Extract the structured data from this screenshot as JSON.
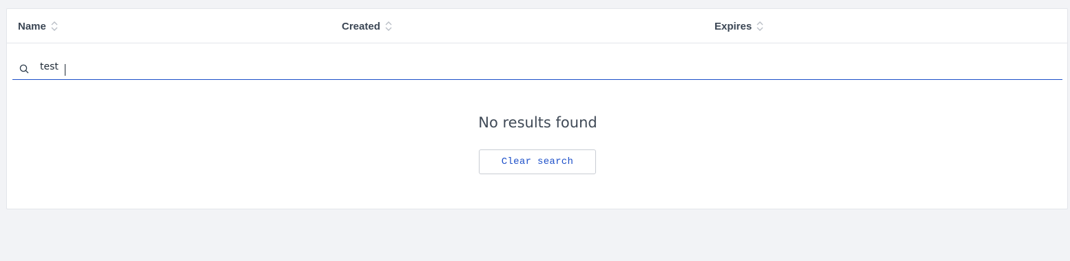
{
  "table": {
    "columns": [
      {
        "label": "Name",
        "sort_icon": "sort-icon"
      },
      {
        "label": "Created",
        "sort_icon": "sort-icon"
      },
      {
        "label": "Expires",
        "sort_icon": "sort-icon"
      }
    ]
  },
  "search": {
    "icon": "search-icon",
    "value": "test"
  },
  "empty_state": {
    "message": "No results found",
    "clear_label": "Clear search"
  },
  "colors": {
    "accent": "#1c4fc9",
    "background": "#f2f3f6",
    "card": "#ffffff",
    "text": "#3b4654"
  }
}
